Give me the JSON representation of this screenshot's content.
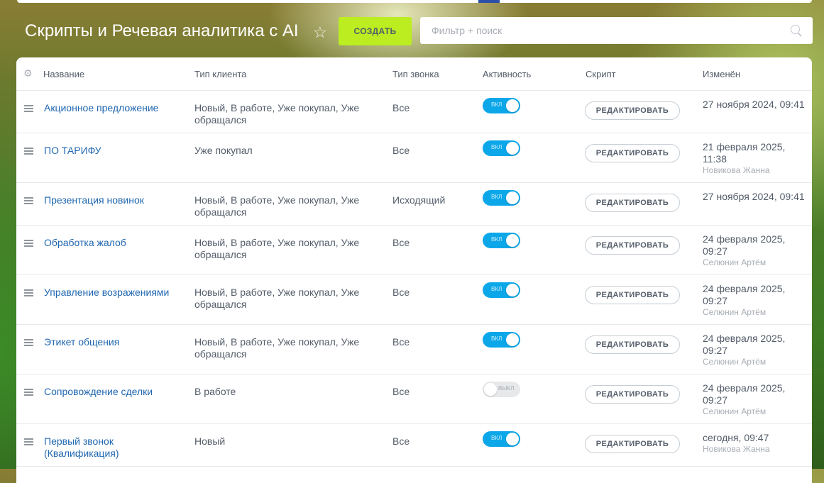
{
  "header": {
    "title": "Скрипты и Речевая аналитика с AI",
    "create_label": "СОЗДАТЬ",
    "search_placeholder": "Фильтр + поиск"
  },
  "table": {
    "columns": [
      "Название",
      "Тип клиента",
      "Тип звонка",
      "Активность",
      "Скрипт",
      "Изменён"
    ],
    "edit_label": "РЕДАКТИРОВАТЬ",
    "rows": [
      {
        "name": "Акционное предложение",
        "client": "Новый, В работе, Уже покупал, Уже обращался",
        "call_type": "Все",
        "active": true,
        "toggle_label": "вкл",
        "changed": "27 ноября 2024, 09:41",
        "author": ""
      },
      {
        "name": "ПО ТАРИФУ",
        "client": "Уже покупал",
        "call_type": "Все",
        "active": true,
        "toggle_label": "вкл",
        "changed": "21 февраля 2025, 11:38",
        "author": "Новикова Жанна"
      },
      {
        "name": "Презентация новинок",
        "client": "Новый, В работе, Уже покупал, Уже обращался",
        "call_type": "Исходящий",
        "active": true,
        "toggle_label": "вкл",
        "changed": "27 ноября 2024, 09:41",
        "author": ""
      },
      {
        "name": "Обработка жалоб",
        "client": "Новый, В работе, Уже покупал, Уже обращался",
        "call_type": "Все",
        "active": true,
        "toggle_label": "вкл",
        "changed": "24 февраля 2025, 09:27",
        "author": "Селюнин Артём"
      },
      {
        "name": "Управление возражениями",
        "client": "Новый, В работе, Уже покупал, Уже обращался",
        "call_type": "Все",
        "active": true,
        "toggle_label": "вкл",
        "changed": "24 февраля 2025, 09:27",
        "author": "Селюнин Артём"
      },
      {
        "name": "Этикет общения",
        "client": "Новый, В работе, Уже покупал, Уже обращался",
        "call_type": "Все",
        "active": true,
        "toggle_label": "вкл",
        "changed": "24 февраля 2025, 09:27",
        "author": "Селюнин Артём"
      },
      {
        "name": "Сопровождение сделки",
        "client": "В работе",
        "call_type": "Все",
        "active": false,
        "toggle_label": "выкл",
        "changed": "24 февраля 2025, 09:27",
        "author": "Селюнин Артём"
      },
      {
        "name": "Первый звонок (Квалификация)",
        "client": "Новый",
        "call_type": "Все",
        "active": true,
        "toggle_label": "вкл",
        "changed": "сегодня, 09:47",
        "author": "Новикова Жанна"
      }
    ]
  }
}
